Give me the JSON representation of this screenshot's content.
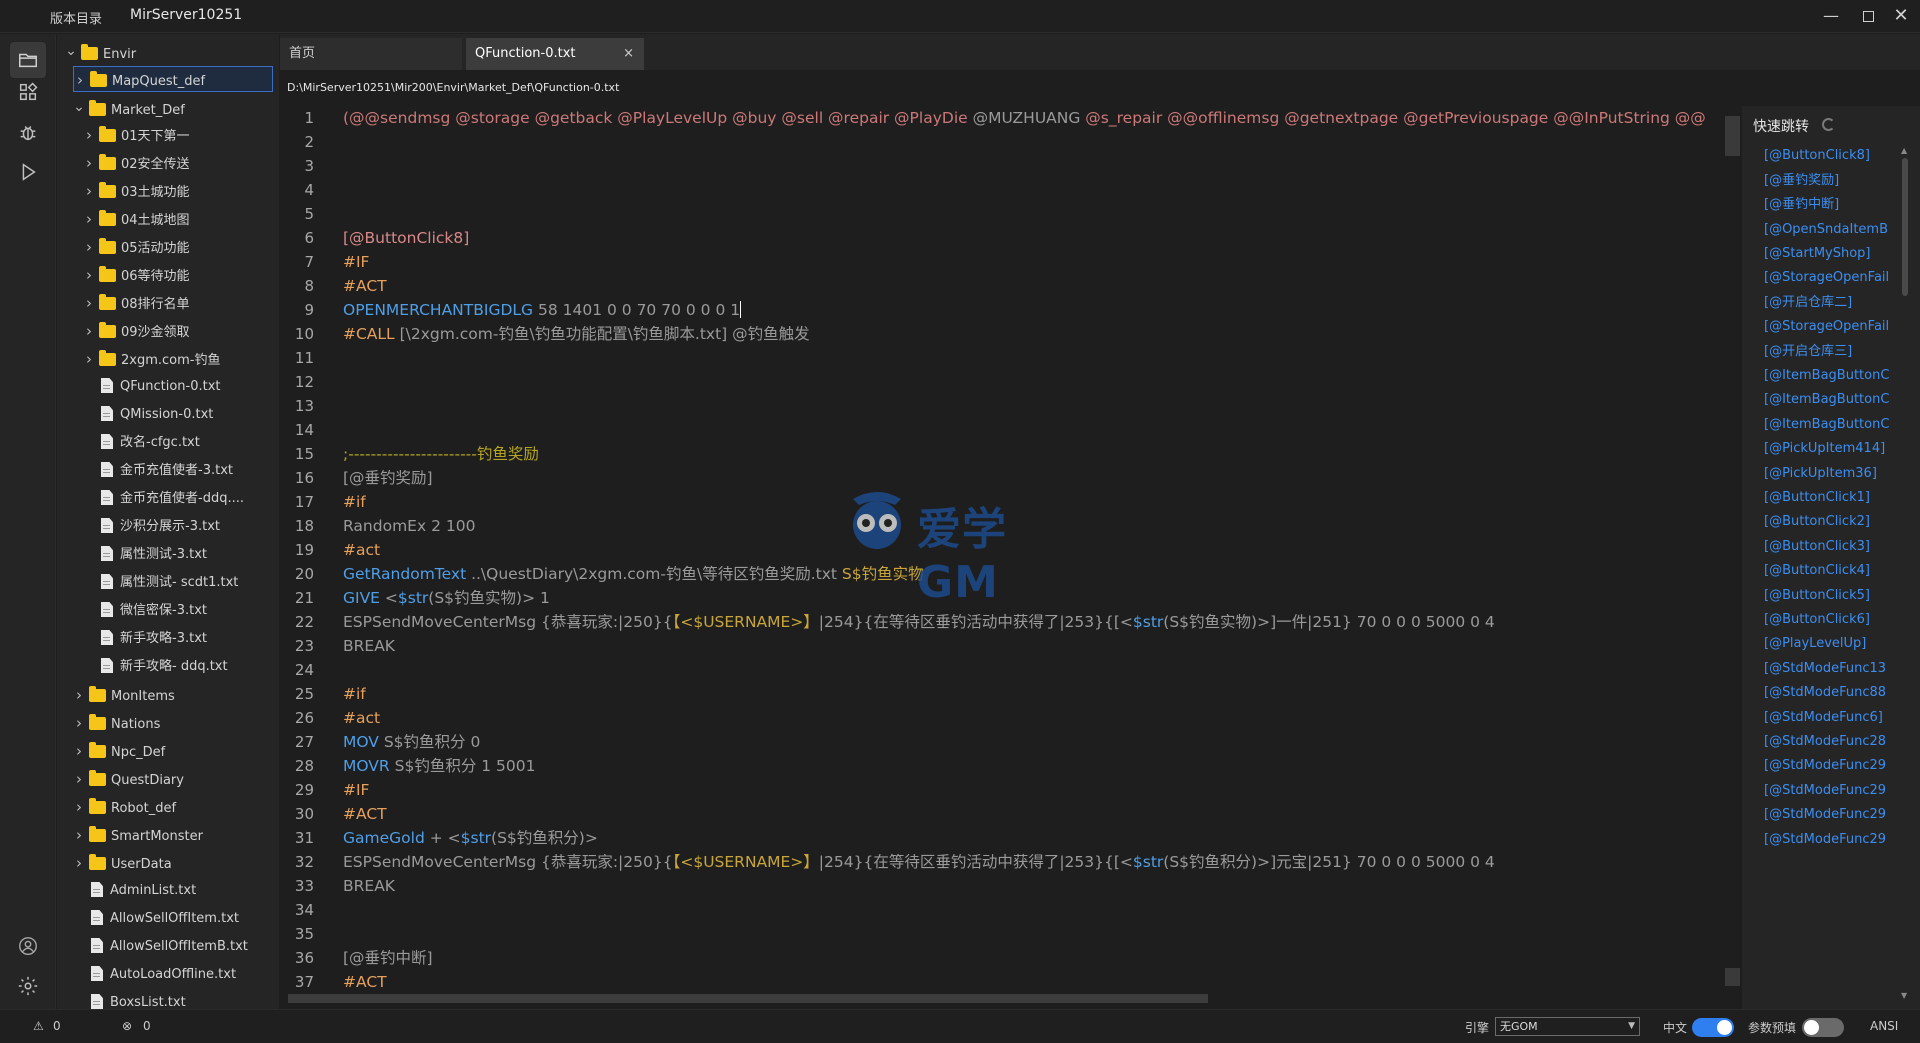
{
  "titlebar": {
    "menu_label": "版本目录",
    "app_title": "MirServer10251"
  },
  "activity": [
    "explorer-icon",
    "extensions-icon",
    "debug-icon",
    "run-icon",
    "account-icon",
    "settings-icon"
  ],
  "explorer": {
    "tree": [
      {
        "label": "Envir",
        "type": "folder",
        "expanded": true
      },
      {
        "label": "MapQuest_def",
        "type": "folder",
        "selected": true
      },
      {
        "label": "Market_Def",
        "type": "folder",
        "expanded": true
      },
      {
        "label": "01天下第一",
        "type": "folder"
      },
      {
        "label": "02安全传送",
        "type": "folder"
      },
      {
        "label": "03土城功能",
        "type": "folder"
      },
      {
        "label": "04土城地图",
        "type": "folder"
      },
      {
        "label": "05活动功能",
        "type": "folder"
      },
      {
        "label": "06等待功能",
        "type": "folder"
      },
      {
        "label": "08排行名单",
        "type": "folder"
      },
      {
        "label": "09沙金领取",
        "type": "folder"
      },
      {
        "label": "2xgm.com-钓鱼",
        "type": "folder"
      },
      {
        "label": "QFunction-0.txt",
        "type": "file"
      },
      {
        "label": "QMission-0.txt",
        "type": "file"
      },
      {
        "label": "改名-cfgc.txt",
        "type": "file"
      },
      {
        "label": "金币充值使者-3.txt",
        "type": "file"
      },
      {
        "label": "金币充值使者-ddq....",
        "type": "file"
      },
      {
        "label": "沙积分展示-3.txt",
        "type": "file"
      },
      {
        "label": "属性测试-3.txt",
        "type": "file"
      },
      {
        "label": "属性测试- scdt1.txt",
        "type": "file"
      },
      {
        "label": "微信密保-3.txt",
        "type": "file"
      },
      {
        "label": "新手攻略-3.txt",
        "type": "file"
      },
      {
        "label": "新手攻略- ddq.txt",
        "type": "file"
      },
      {
        "label": "MonItems",
        "type": "folder"
      },
      {
        "label": "Nations",
        "type": "folder"
      },
      {
        "label": "Npc_Def",
        "type": "folder"
      },
      {
        "label": "QuestDiary",
        "type": "folder"
      },
      {
        "label": "Robot_def",
        "type": "folder"
      },
      {
        "label": "SmartMonster",
        "type": "folder"
      },
      {
        "label": "UserData",
        "type": "folder"
      },
      {
        "label": "AdminList.txt",
        "type": "file"
      },
      {
        "label": "AllowSellOffItem.txt",
        "type": "file"
      },
      {
        "label": "AllowSellOffItemB.txt",
        "type": "file"
      },
      {
        "label": "AutoLoadOffline.txt",
        "type": "file"
      },
      {
        "label": "BoxsList.txt",
        "type": "file"
      }
    ]
  },
  "tabs": {
    "home": "首页",
    "current": "QFunction-0.txt",
    "close": "×"
  },
  "path": "D:\\MirServer10251\\Mir200\\Envir\\Market_Def\\QFunction-0.txt",
  "editor": {
    "lines": [
      {
        "n": "1",
        "segs": [
          [
            "t-head",
            "(@@sendmsg @storage @getback @PlayLevelUp  @buy @sell @repair @PlayDie "
          ],
          [
            "t-plain",
            "@MUZHUANG"
          ],
          [
            "t-head",
            " @s_repair @@offlinemsg @getnextpage @getPreviouspage @@InPutString  @@"
          ]
        ]
      },
      {
        "n": "2",
        "segs": []
      },
      {
        "n": "3",
        "segs": []
      },
      {
        "n": "4",
        "segs": []
      },
      {
        "n": "5",
        "segs": []
      },
      {
        "n": "6",
        "segs": [
          [
            "t-label",
            "[@ButtonClick8]"
          ]
        ]
      },
      {
        "n": "7",
        "segs": [
          [
            "t-kw",
            "#IF"
          ]
        ]
      },
      {
        "n": "8",
        "segs": [
          [
            "t-kw",
            "#ACT"
          ]
        ]
      },
      {
        "n": "9",
        "segs": [
          [
            "t-cmd",
            "OPENMERCHANTBIGDLG"
          ],
          [
            "t-plain",
            " 58 1401 0 0 70 70 0 0 0 1"
          ]
        ],
        "cursor": true
      },
      {
        "n": "10",
        "segs": [
          [
            "t-kw",
            "#CALL"
          ],
          [
            "t-plain",
            " [\\2xgm.com-钓鱼\\钓鱼功能配置\\钓鱼脚本.txt] @钓鱼触发"
          ]
        ]
      },
      {
        "n": "11",
        "segs": []
      },
      {
        "n": "12",
        "segs": []
      },
      {
        "n": "13",
        "segs": []
      },
      {
        "n": "14",
        "segs": []
      },
      {
        "n": "15",
        "segs": [
          [
            "t-comment",
            ";-----------------------钓鱼奖励"
          ]
        ]
      },
      {
        "n": "16",
        "segs": [
          [
            "t-plain",
            "[@垂钓奖励]"
          ]
        ]
      },
      {
        "n": "17",
        "segs": [
          [
            "t-kw",
            "#if"
          ]
        ]
      },
      {
        "n": "18",
        "segs": [
          [
            "t-plain",
            "RandomEx 2 100"
          ]
        ]
      },
      {
        "n": "19",
        "segs": [
          [
            "t-kw",
            "#act"
          ]
        ]
      },
      {
        "n": "20",
        "segs": [
          [
            "t-cmd",
            "GetRandomText"
          ],
          [
            "t-plain",
            " ..\\QuestDiary\\2xgm.com-钓鱼\\等待区钓鱼奖励.txt "
          ],
          [
            "t-str",
            "S$钓鱼实物"
          ]
        ]
      },
      {
        "n": "21",
        "segs": [
          [
            "t-cmd",
            "GIVE"
          ],
          [
            "t-plain",
            " <"
          ],
          [
            "t-var",
            "$str"
          ],
          [
            "t-plain",
            "(S$钓鱼实物)> 1"
          ]
        ]
      },
      {
        "n": "22",
        "segs": [
          [
            "t-plain",
            "ESPSendMoveCenterMsg {恭喜玩家:|250}{"
          ],
          [
            "t-str",
            "【<$USERNAME>】"
          ],
          [
            "t-plain",
            "|254}{在等待区垂钓活动中获得了|253}{[<"
          ],
          [
            "t-var",
            "$str"
          ],
          [
            "t-plain",
            "(S$钓鱼实物)>]一件|251} 70 0 0 0 5000 0 4"
          ]
        ]
      },
      {
        "n": "23",
        "segs": [
          [
            "t-plain",
            "BREAK"
          ]
        ]
      },
      {
        "n": "24",
        "segs": []
      },
      {
        "n": "25",
        "segs": [
          [
            "t-kw",
            "#if"
          ]
        ]
      },
      {
        "n": "26",
        "segs": [
          [
            "t-kw",
            "#act"
          ]
        ]
      },
      {
        "n": "27",
        "segs": [
          [
            "t-cmd",
            "MOV"
          ],
          [
            "t-plain",
            " S$钓鱼积分 0"
          ]
        ]
      },
      {
        "n": "28",
        "segs": [
          [
            "t-cmd",
            "MOVR"
          ],
          [
            "t-plain",
            " S$钓鱼积分 1 5001"
          ]
        ]
      },
      {
        "n": "29",
        "segs": [
          [
            "t-kw",
            "#IF"
          ]
        ]
      },
      {
        "n": "30",
        "segs": [
          [
            "t-kw",
            "#ACT"
          ]
        ]
      },
      {
        "n": "31",
        "segs": [
          [
            "t-cmd",
            "GameGold"
          ],
          [
            "t-plain",
            " + <"
          ],
          [
            "t-var",
            "$str"
          ],
          [
            "t-plain",
            "(S$钓鱼积分)>"
          ]
        ]
      },
      {
        "n": "32",
        "segs": [
          [
            "t-plain",
            "ESPSendMoveCenterMsg {恭喜玩家:|250}{"
          ],
          [
            "t-str",
            "【<$USERNAME>】"
          ],
          [
            "t-plain",
            "|254}{在等待区垂钓活动中获得了|253}{[<"
          ],
          [
            "t-var",
            "$str"
          ],
          [
            "t-plain",
            "(S$钓鱼积分)>]元宝|251} 70 0 0 0 5000 0 4"
          ]
        ]
      },
      {
        "n": "33",
        "segs": [
          [
            "t-plain",
            "BREAK"
          ]
        ]
      },
      {
        "n": "34",
        "segs": []
      },
      {
        "n": "35",
        "segs": []
      },
      {
        "n": "36",
        "segs": [
          [
            "t-plain",
            "[@垂钓中断]"
          ]
        ]
      },
      {
        "n": "37",
        "segs": [
          [
            "t-kw",
            "#ACT"
          ]
        ]
      }
    ]
  },
  "watermark": "爱学GM",
  "quickjump": {
    "title": "快速跳转",
    "items": [
      "[@ButtonClick8]",
      "[@垂钓奖励]",
      "[@垂钓中断]",
      "[@OpenSndaItemB",
      "[@StartMyShop]",
      "[@StorageOpenFail",
      "[@开启仓库二]",
      "[@StorageOpenFail",
      "[@开启仓库三]",
      "[@ItemBagButtonC",
      "[@ItemBagButtonC",
      "[@ItemBagButtonC",
      "[@PickUpItem414]",
      "[@PickUpItem36]",
      "[@ButtonClick1]",
      "[@ButtonClick2]",
      "[@ButtonClick3]",
      "[@ButtonClick4]",
      "[@ButtonClick5]",
      "[@ButtonClick6]",
      "[@PlayLevelUp]",
      "[@StdModeFunc13",
      "[@StdModeFunc88",
      "[@StdModeFunc6]",
      "[@StdModeFunc28",
      "[@StdModeFunc29",
      "[@StdModeFunc29",
      "[@StdModeFunc29",
      "[@StdModeFunc29"
    ]
  },
  "status": {
    "warnings": "0",
    "errors": "0",
    "engine_label": "引擎",
    "engine_value": "无GOM",
    "lang_label": "中文",
    "lang_on": true,
    "param_label": "参数预填",
    "param_on": false,
    "encoding": "ANSI"
  },
  "colors": {
    "accent": "#2f7ff0",
    "keyword": "#e6a05a",
    "command": "#4f9fe8",
    "label": "#d98888",
    "folder": "#f5c518"
  }
}
